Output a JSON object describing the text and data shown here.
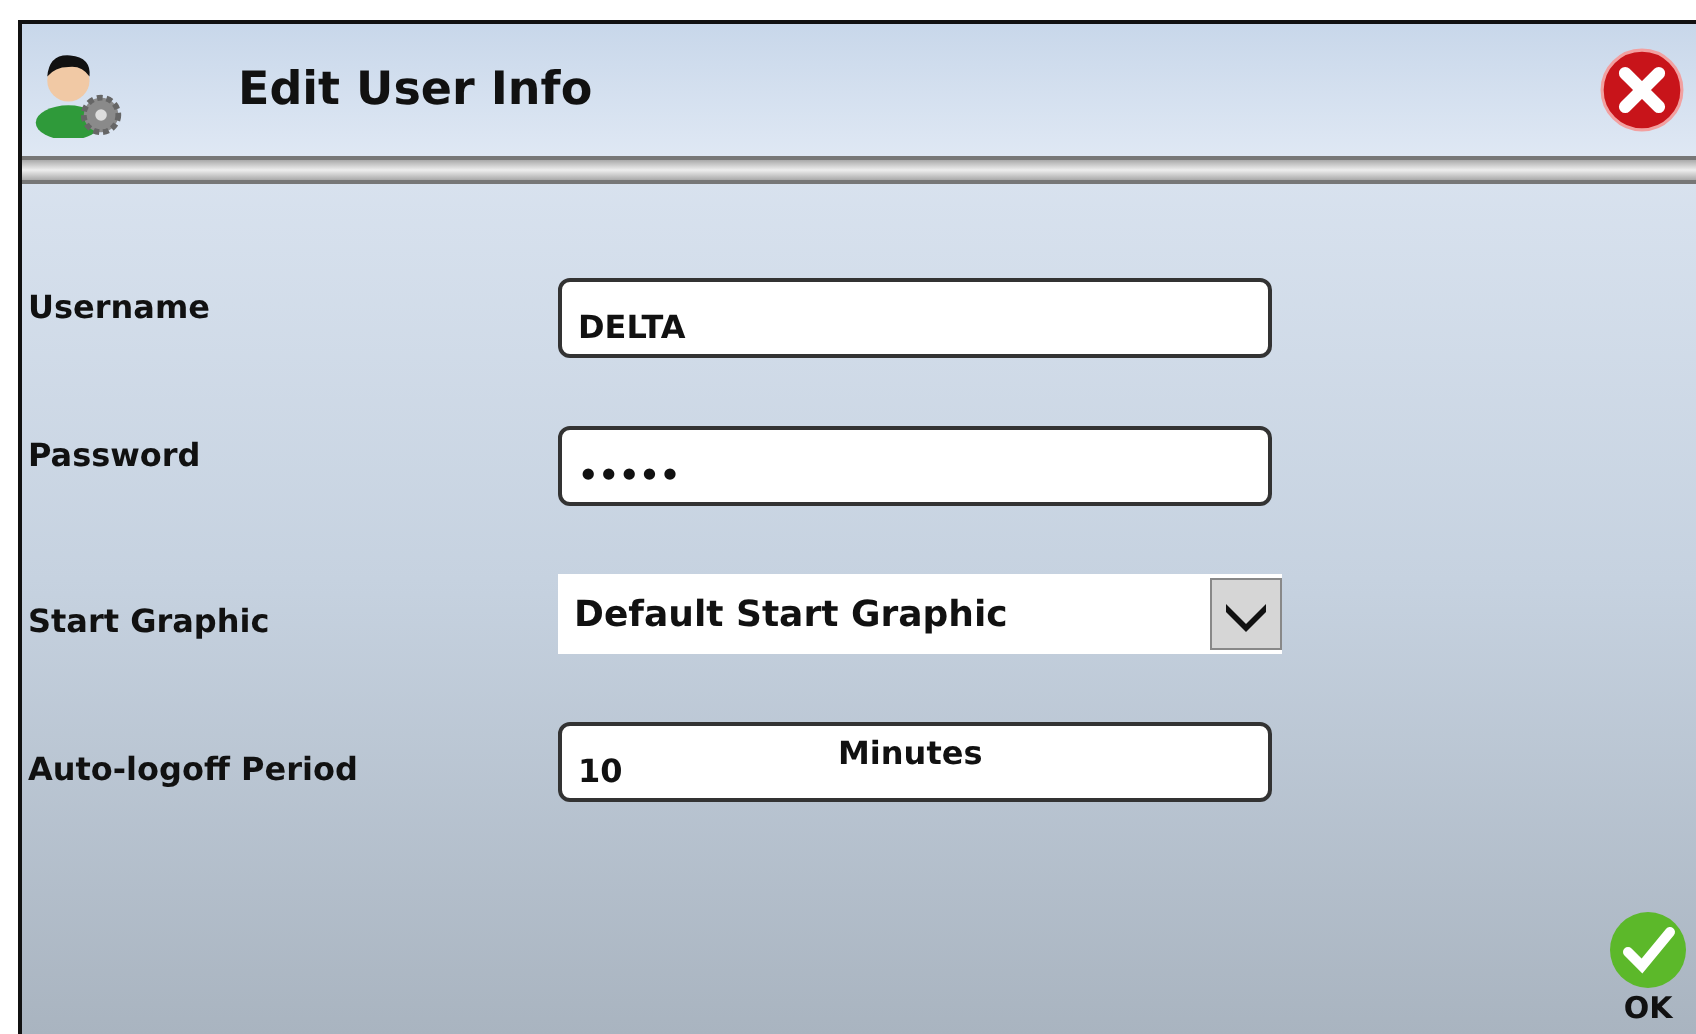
{
  "window": {
    "title": "Edit User Info"
  },
  "fields": [
    {
      "kind": "text",
      "label": "Username",
      "value": "DELTA"
    },
    {
      "kind": "password",
      "label": "Password",
      "value": "•••••"
    },
    {
      "kind": "dropdown",
      "label": "Start Graphic",
      "value": "Default Start Graphic"
    },
    {
      "kind": "duration",
      "label": "Auto-logoff Period",
      "value": "10",
      "unit": "Minutes"
    }
  ],
  "ok_button": {
    "label": "OK"
  }
}
